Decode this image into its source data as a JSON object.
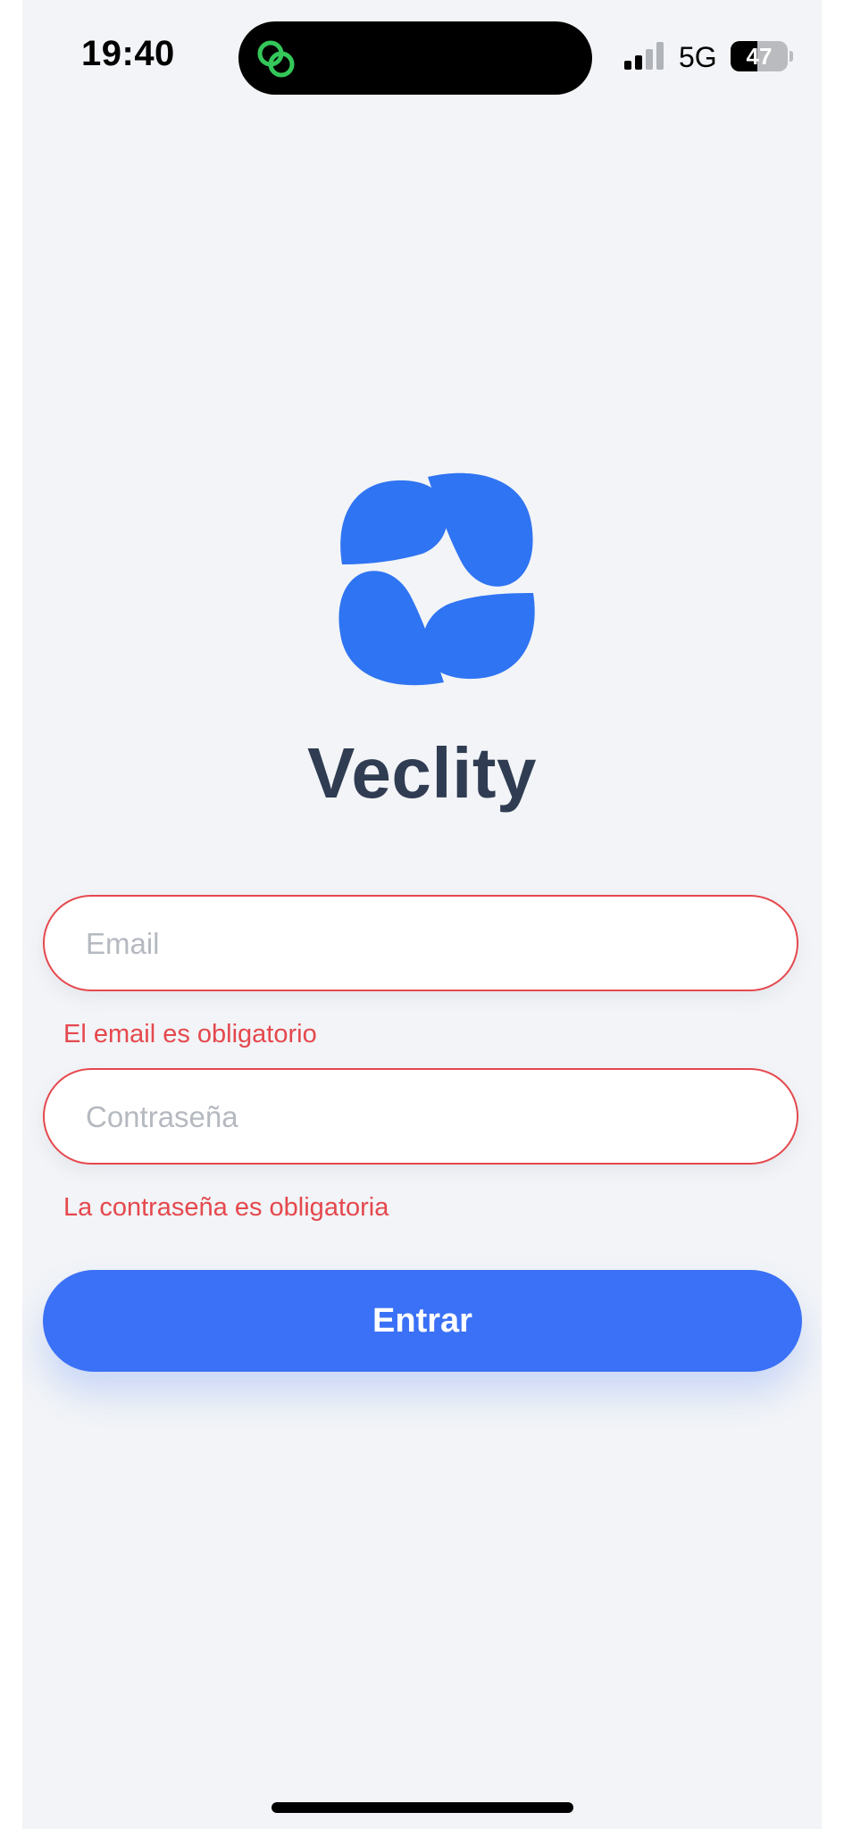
{
  "status_bar": {
    "time": "19:40",
    "network": "5G",
    "battery_level": "47",
    "battery_fraction": 0.47,
    "live_activity_icon": "linked-circles-icon",
    "live_activity_color": "#34c759"
  },
  "app": {
    "name": "Veclity",
    "logo_icon": "pinwheel-logo-icon",
    "brand_color": "#2f74f2"
  },
  "form": {
    "email": {
      "placeholder": "Email",
      "value": "",
      "error": "El email es obligatorio"
    },
    "password": {
      "placeholder": "Contraseña",
      "value": "",
      "error": "La contraseña es obligatoria"
    },
    "submit_label": "Entrar",
    "error_color": "#e5484d",
    "button_color": "#3b71f6"
  }
}
